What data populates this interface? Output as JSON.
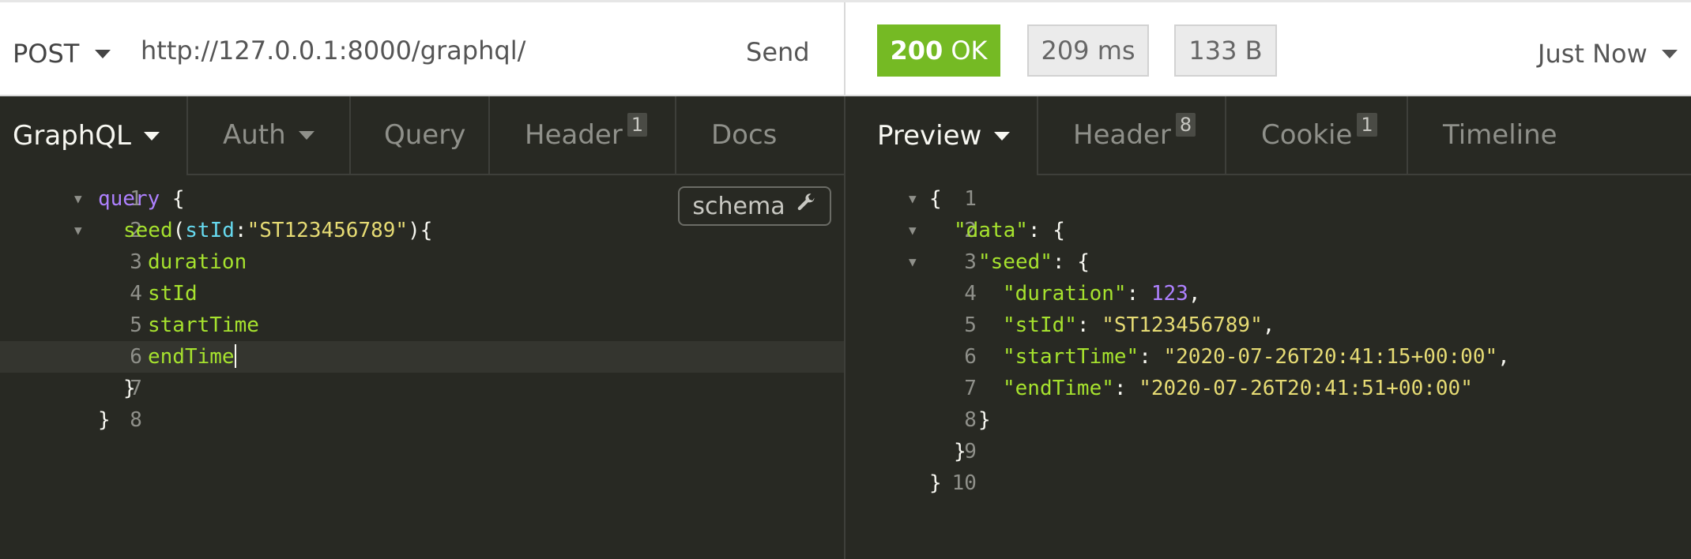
{
  "request": {
    "method": "POST",
    "url": "http://127.0.0.1:8000/graphql/",
    "send_label": "Send"
  },
  "response": {
    "status_code": "200",
    "status_text": "OK",
    "time": "209 ms",
    "size": "133 B",
    "history_label": "Just Now"
  },
  "request_tabs": [
    {
      "label": "GraphQL"
    },
    {
      "label": "Auth"
    },
    {
      "label": "Query"
    },
    {
      "label": "Header",
      "count": "1"
    },
    {
      "label": "Docs"
    }
  ],
  "response_tabs": [
    {
      "label": "Preview"
    },
    {
      "label": "Header",
      "count": "8"
    },
    {
      "label": "Cookie",
      "count": "1"
    },
    {
      "label": "Timeline"
    }
  ],
  "schema_button": {
    "label": "schema",
    "icon": "wrench-icon"
  },
  "query_editor": {
    "line_numbers": [
      "1",
      "2",
      "3",
      "4",
      "5",
      "6",
      "7",
      "8"
    ],
    "lines": {
      "l1_kw": "query",
      "l1_rest": " {",
      "l2_fn": "seed",
      "l2_open": "(",
      "l2_arg": "stId",
      "l2_colon": ":",
      "l2_str": "\"ST123456789\"",
      "l2_close": "){",
      "l3": "duration",
      "l4": "stId",
      "l5": "startTime",
      "l6": "endTime",
      "l7": "}",
      "l8": "}"
    }
  },
  "response_body": {
    "line_numbers": [
      "1",
      "2",
      "3",
      "4",
      "5",
      "6",
      "7",
      "8",
      "9",
      "10"
    ],
    "lines": {
      "l1": "{",
      "l2_key": "\"data\"",
      "l2_rest": ": {",
      "l3_key": "\"seed\"",
      "l3_rest": ": {",
      "l4_key": "\"duration\"",
      "l4_sep": ": ",
      "l4_val": "123",
      "l4_end": ",",
      "l5_key": "\"stId\"",
      "l5_sep": ": ",
      "l5_val": "\"ST123456789\"",
      "l5_end": ",",
      "l6_key": "\"startTime\"",
      "l6_sep": ": ",
      "l6_val": "\"2020-07-26T20:41:15+00:00\"",
      "l6_end": ",",
      "l7_key": "\"endTime\"",
      "l7_sep": ": ",
      "l7_val": "\"2020-07-26T20:41:51+00:00\"",
      "l8": "}",
      "l9": "}",
      "l10": "}"
    }
  },
  "colors": {
    "status_ok": "#75ba24",
    "editor_bg": "#282923",
    "keyword": "#ae81ff",
    "field": "#a6e22e",
    "argument": "#66d9ef",
    "string": "#e6db74"
  }
}
